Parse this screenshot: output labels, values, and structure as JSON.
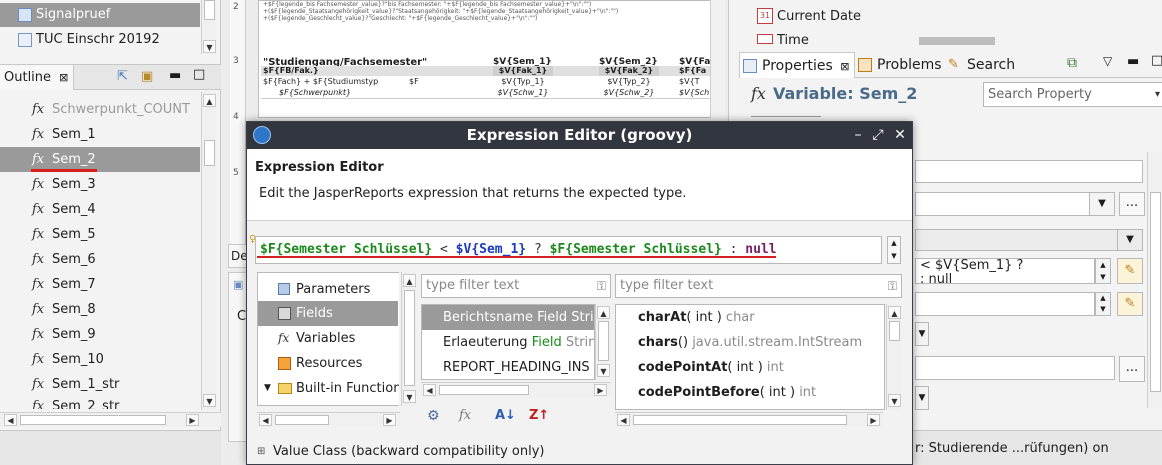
{
  "left": {
    "top_rows": [
      "Signalpruef",
      "TUC Einschr 20192"
    ],
    "outline_tab": "Outline",
    "items": [
      "Schwerpunkt_COUNT",
      "Sem_1",
      "Sem_2",
      "Sem_3",
      "Sem_4",
      "Sem_5",
      "Sem_6",
      "Sem_7",
      "Sem_8",
      "Sem_9",
      "Sem_10",
      "Sem_1_str",
      "Sem_2_str"
    ],
    "fx_symbol": "fx"
  },
  "report": {
    "header_title": "\"Studiengang/Fachsemester\"",
    "columns": [
      "$V{Sem_1}",
      "$V{Sem_2}",
      "$V{Fa"
    ],
    "row1": [
      "$F{FB/Fak.}",
      "$V{Fak_1}",
      "$V{Fak_2}",
      "$F{Fa"
    ],
    "row2": [
      "$F{Fach} + $F{Studiumstyp",
      "$F",
      "$V{Typ_1}",
      "$V{Typ_2}",
      "$V{T"
    ],
    "row3": [
      "$F{Schwerpunkt}",
      "$V{Schw_1}",
      "$V{Schw_2}",
      "$V{Sch"
    ],
    "small_text_1": "+$F{legende_bis Fachsemester_value}?\"bis Fachsemester: \"+$F{legende_bis Fachsemester_value}+\"\\n\":\"\")",
    "small_text_2": "+($F{legende_Staatsangehörigkeit_value}?\"Staatsangehörigkeit: \"+$F{legende_Staatsangehörigkeit_value}+\"\\n\":\"\")",
    "small_text_3": "+($F{legende_Geschlecht_value}?\"Geschlecht: \"+$F{legende_Geschlecht_value}+\"\\n\":\"\")",
    "ruler": [
      "2",
      "3",
      "4",
      "5"
    ],
    "tab_partial": "De",
    "c_partial": "C"
  },
  "right": {
    "top_items": [
      "Current Date",
      "Time"
    ],
    "tabs": [
      "Properties",
      "Problems",
      "Search"
    ],
    "variable_title": "Variable: Sem_2",
    "search_placeholder": "Search Property",
    "expr_snippet_1": "< $V{Sem_1} ?",
    "expr_snippet_2": ": null",
    "status_text": "r: Studierende ...rüfungen) on",
    "ellipsis": "..."
  },
  "dialog": {
    "title": "Expression Editor (groovy)",
    "heading": "Expression Editor",
    "description": "Edit the JasperReports expression that returns the expected type.",
    "expression": {
      "f1": "$F{Semester Schlüssel}",
      "op1": " < ",
      "v1": "$V{Sem_1}",
      "op2": " ? ",
      "f2": "$F{Semester Schlüssel}",
      "op3": " : ",
      "null": "null"
    },
    "categories": [
      "Parameters",
      "Fields",
      "Variables",
      "Resources",
      "Built-in Function"
    ],
    "filter_placeholder_1": "type filter text",
    "filter_placeholder_2": "type filter text",
    "fields": [
      {
        "name": "Berichtsname",
        "kind": "Field",
        "type": "Stri"
      },
      {
        "name": "Erlaeuterung",
        "kind": "Field",
        "type": "Strin"
      },
      {
        "name": "REPORT_HEADING_INS",
        "kind": "",
        "type": ""
      }
    ],
    "methods": [
      {
        "name": "charAt",
        "args": "( int )",
        "ret": "char"
      },
      {
        "name": "chars",
        "args": "()",
        "ret": "java.util.stream.IntStream"
      },
      {
        "name": "codePointAt",
        "args": "( int )",
        "ret": "int"
      },
      {
        "name": "codePointBefore",
        "args": "( int )",
        "ret": "int"
      }
    ],
    "value_class": "Value Class (backward compatibility only)",
    "colors": {
      "field": "#1a8a1a",
      "variable": "#1b3bbb",
      "null": "#7a1d6b",
      "underline": "#d62020",
      "titlebar": "#32363f"
    }
  }
}
